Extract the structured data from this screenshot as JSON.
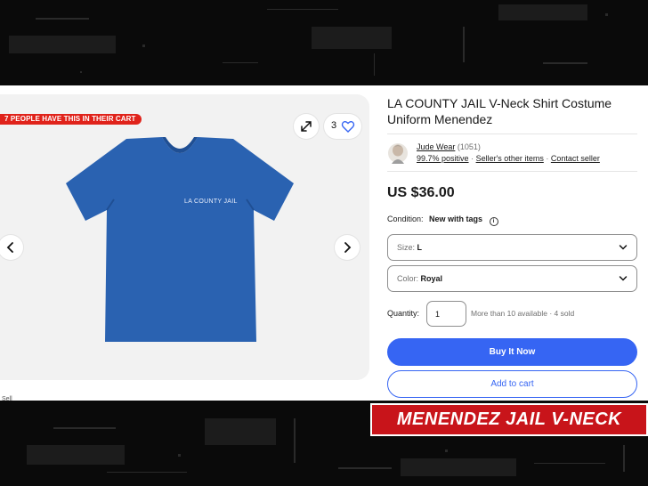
{
  "listing": {
    "title": "LA COUNTY JAIL V-Neck Shirt Costume Uniform Menendez",
    "cart_badge": "7 PEOPLE HAVE THIS IN THEIR CART",
    "watch_count": "3",
    "shirt_print": "LA COUNTY JAIL",
    "partial_text": "Sell",
    "seller": {
      "name": "Jude Wear",
      "feedback_count": "(1051)",
      "positive": "99.7% positive",
      "other_items": "Seller's other items",
      "contact": "Contact seller",
      "separator": "·"
    },
    "price": "US $36.00",
    "condition_label": "Condition:",
    "condition_value": "New with tags",
    "size": {
      "label": "Size:",
      "value": "L"
    },
    "color": {
      "label": "Color:",
      "value": "Royal"
    },
    "quantity_label": "Quantity:",
    "quantity_value": "1",
    "availability": "More than 10 available · 4 sold",
    "buy_now": "Buy It Now",
    "add_to_cart": "Add to cart"
  },
  "caption": "MENENDEZ JAIL V-NECK",
  "colors": {
    "badge_red": "#e0231b",
    "ebay_blue": "#3665f3",
    "shirt_royal": "#2a62b1",
    "caption_red": "#c8141a"
  },
  "icons": [
    "expand-icon",
    "heart-icon",
    "chevron-left-icon",
    "chevron-right-icon",
    "chevron-down-icon",
    "info-icon"
  ]
}
